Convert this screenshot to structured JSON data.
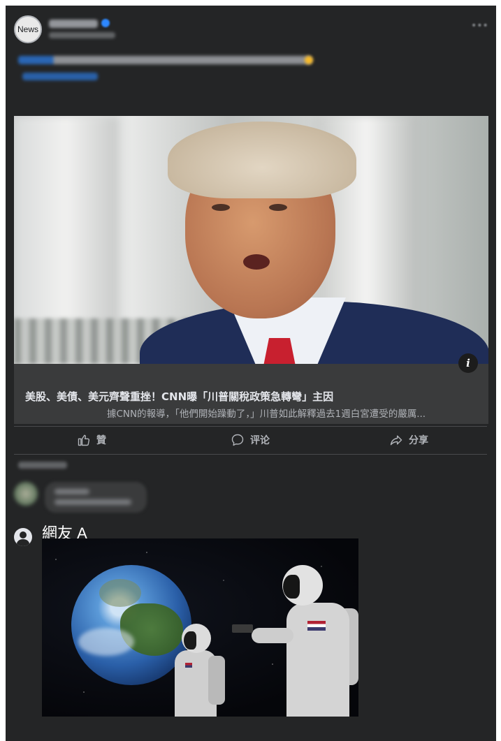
{
  "post": {
    "page_avatar_text": "News",
    "link_preview": {
      "title": "美股、美債、美元齊聲重挫！CNN曝「川普關稅政策急轉彎」主因",
      "description": "據CNN的報導，「他們開始躁動了，」川普如此解釋過去1週白宮遭受的嚴厲..."
    }
  },
  "actions": {
    "like_label": "贊",
    "comment_label": "评论",
    "share_label": "分享"
  },
  "reply": {
    "author": "網友 A"
  },
  "colors": {
    "card_bg": "#242526",
    "link_box_bg": "#3a3b3c",
    "text_primary": "#e4e6eb",
    "text_secondary": "#b0b3b8"
  },
  "icons": {
    "info": "info-icon",
    "like": "thumbs-up-icon",
    "comment": "speech-bubble-icon",
    "share": "share-arrow-icon",
    "user": "user-silhouette-icon"
  }
}
